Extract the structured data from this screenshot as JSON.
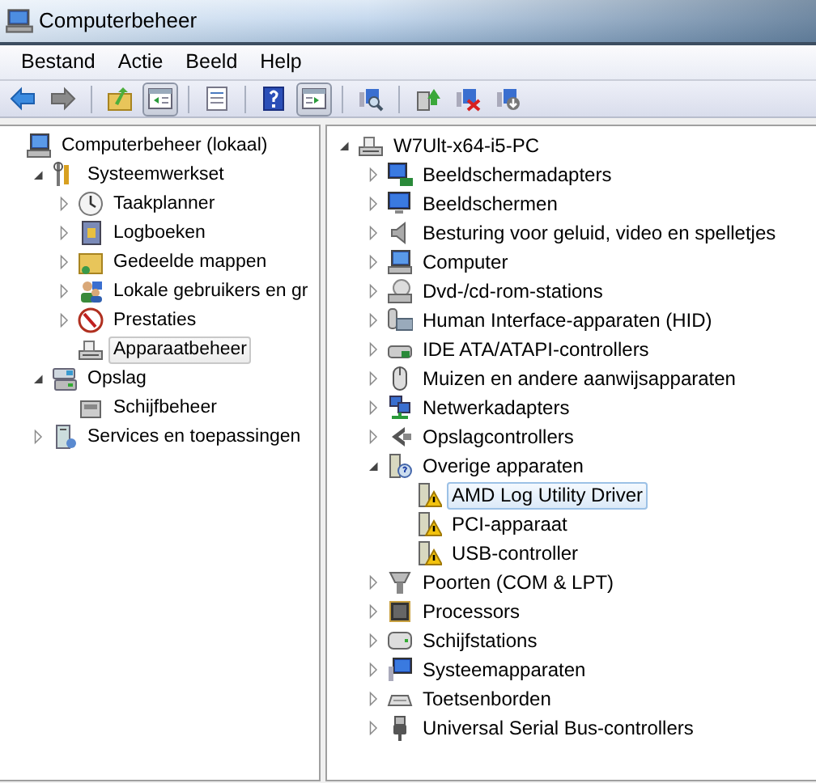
{
  "window": {
    "title": "Computerbeheer"
  },
  "menu": [
    {
      "label": "Bestand"
    },
    {
      "label": "Actie"
    },
    {
      "label": "Beeld"
    },
    {
      "label": "Help"
    }
  ],
  "toolbar": [
    {
      "kind": "button",
      "pressed": false
    },
    {
      "kind": "button",
      "pressed": false
    },
    {
      "kind": "separator"
    },
    {
      "kind": "button",
      "pressed": false
    },
    {
      "kind": "button",
      "pressed": true
    },
    {
      "kind": "separator"
    },
    {
      "kind": "button",
      "pressed": false
    },
    {
      "kind": "separator"
    },
    {
      "kind": "button",
      "pressed": false
    },
    {
      "kind": "button",
      "pressed": true
    },
    {
      "kind": "separator"
    },
    {
      "kind": "button",
      "pressed": false
    },
    {
      "kind": "separator"
    },
    {
      "kind": "button",
      "pressed": false
    },
    {
      "kind": "button",
      "pressed": false
    },
    {
      "kind": "button",
      "pressed": false
    }
  ],
  "left_tree": [
    {
      "label": "Computerbeheer (lokaal)",
      "selected": false,
      "children": [
        {
          "label": "Systeemwerkset",
          "expanded": true,
          "selected": false,
          "children": [
            {
              "label": "Taakplanner",
              "expanded": false,
              "selected": false
            },
            {
              "label": "Logboeken",
              "expanded": false,
              "selected": false
            },
            {
              "label": "Gedeelde mappen",
              "expanded": false,
              "selected": false
            },
            {
              "label": "Lokale gebruikers en gr",
              "expanded": false,
              "selected": false
            },
            {
              "label": "Prestaties",
              "expanded": false,
              "selected": false
            },
            {
              "label": "Apparaatbeheer",
              "selected": true
            }
          ]
        },
        {
          "label": "Opslag",
          "expanded": true,
          "selected": false,
          "children": [
            {
              "label": "Schijfbeheer",
              "selected": false
            }
          ]
        },
        {
          "label": "Services en toepassingen",
          "expanded": false,
          "selected": false
        }
      ]
    }
  ],
  "device_tree": [
    {
      "label": "W7Ult-x64-i5-PC",
      "expanded": true,
      "selected": false,
      "children": [
        {
          "label": "Beeldschermadapters",
          "expanded": false,
          "selected": false
        },
        {
          "label": "Beeldschermen",
          "expanded": false,
          "selected": false
        },
        {
          "label": "Besturing voor geluid, video en spelletjes",
          "expanded": false,
          "selected": false
        },
        {
          "label": "Computer",
          "expanded": false,
          "selected": false
        },
        {
          "label": "Dvd-/cd-rom-stations",
          "expanded": false,
          "selected": false
        },
        {
          "label": "Human Interface-apparaten (HID)",
          "expanded": false,
          "selected": false
        },
        {
          "label": "IDE ATA/ATAPI-controllers",
          "expanded": false,
          "selected": false
        },
        {
          "label": "Muizen en andere aanwijsapparaten",
          "expanded": false,
          "selected": false
        },
        {
          "label": "Netwerkadapters",
          "expanded": false,
          "selected": false
        },
        {
          "label": "Opslagcontrollers",
          "expanded": false,
          "selected": false
        },
        {
          "label": "Overige apparaten",
          "expanded": true,
          "selected": false,
          "children": [
            {
              "label": "AMD Log Utility Driver",
              "selected": true,
              "warning": true
            },
            {
              "label": "PCI-apparaat",
              "selected": false,
              "warning": true
            },
            {
              "label": "USB-controller",
              "selected": false,
              "warning": true
            }
          ]
        },
        {
          "label": "Poorten (COM & LPT)",
          "expanded": false,
          "selected": false
        },
        {
          "label": "Processors",
          "expanded": false,
          "selected": false
        },
        {
          "label": "Schijfstations",
          "expanded": false,
          "selected": false
        },
        {
          "label": "Systeemapparaten",
          "expanded": false,
          "selected": false
        },
        {
          "label": "Toetsenborden",
          "expanded": false,
          "selected": false
        },
        {
          "label": "Universal Serial Bus-controllers",
          "expanded": false,
          "selected": false
        }
      ]
    }
  ]
}
